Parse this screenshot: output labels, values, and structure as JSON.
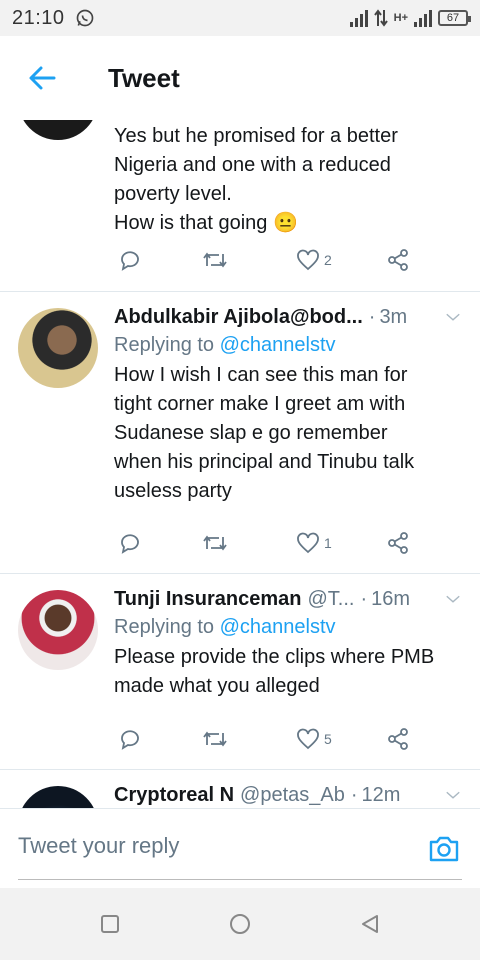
{
  "status_bar": {
    "time": "21:10",
    "battery": "67",
    "network": "H+"
  },
  "header": {
    "title": "Tweet"
  },
  "tweets": [
    {
      "text_lines": [
        "Yes but he promised for a better",
        "Nigeria and one with a reduced",
        "poverty level.",
        "How is that going 😐"
      ],
      "likes": "2"
    },
    {
      "name": "Abdulkabir Ajibola@bod...",
      "handle": "",
      "time": "3m",
      "replying_prefix": "Replying to",
      "replying_to": "@channelstv",
      "text_lines": [
        "How I wish I can see this man for",
        "tight corner make I greet am with",
        "Sudanese slap e go remember",
        "when his principal and Tinubu talk",
        "useless party"
      ],
      "likes": "1"
    },
    {
      "name": "Tunji Insuranceman",
      "handle": "@T...",
      "time": "16m",
      "replying_prefix": "Replying to",
      "replying_to": "@channelstv",
      "text_lines": [
        "Please provide the clips where PMB",
        "made what you alleged"
      ],
      "likes": "5"
    },
    {
      "name": "Cryptoreal N",
      "handle": "@petas_Ab",
      "time": "12m"
    }
  ],
  "reply_bar": {
    "placeholder": "Tweet your reply"
  },
  "colors": {
    "accent": "#1da1f2",
    "text": "#14171a",
    "secondary": "#657786"
  },
  "icons": [
    "back-arrow-icon",
    "reply-icon",
    "retweet-icon",
    "like-icon",
    "share-icon",
    "chevron-down-icon",
    "camera-icon"
  ]
}
